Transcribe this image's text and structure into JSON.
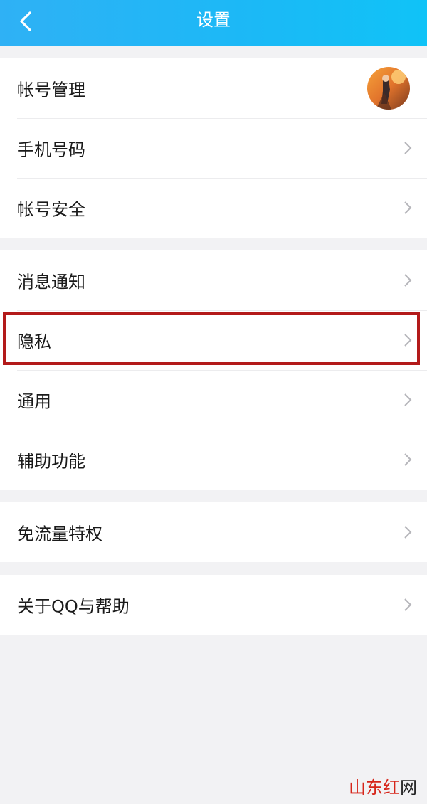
{
  "header": {
    "title": "设置",
    "back_icon": "chevron-left-icon"
  },
  "groups": [
    {
      "items": [
        {
          "label": "帐号管理"
        },
        {
          "label": "手机号码"
        },
        {
          "label": "帐号安全"
        }
      ]
    },
    {
      "items": [
        {
          "label": "消息通知"
        },
        {
          "label": "隐私"
        },
        {
          "label": "通用"
        },
        {
          "label": "辅助功能"
        }
      ]
    },
    {
      "items": [
        {
          "label": "免流量特权"
        }
      ]
    },
    {
      "items": [
        {
          "label": "关于QQ与帮助"
        }
      ]
    }
  ],
  "highlight": {
    "target": "隐私",
    "color": "#b31a1a"
  },
  "colors": {
    "header_start": "#2fb1f5",
    "header_end": "#10c3f7",
    "page_bg": "#f2f2f4"
  },
  "watermark": {
    "part1": "山东红",
    "part2": "网"
  }
}
